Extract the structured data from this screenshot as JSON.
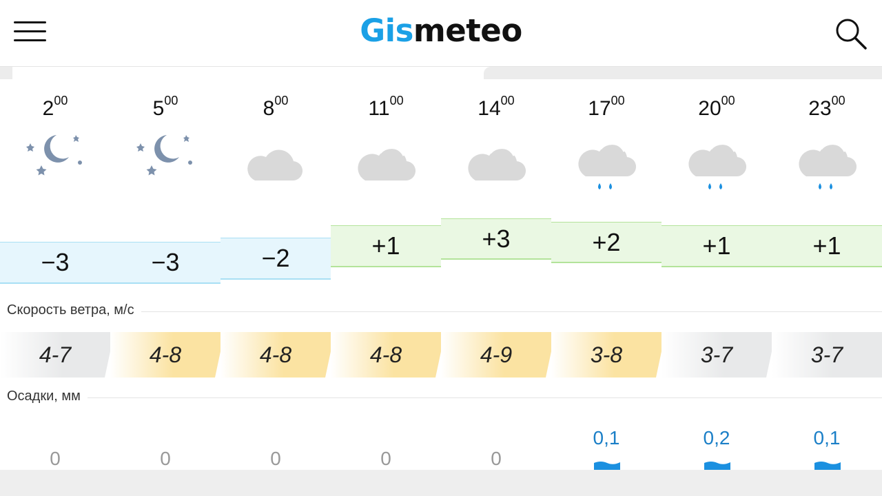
{
  "header": {
    "logo_part1": "Gis",
    "logo_part2": "meteo"
  },
  "forecast": [
    {
      "hour": "2",
      "minutes": "00",
      "icon": "moon-stars-icon",
      "temp": "−3",
      "wind": "4-7",
      "precip": "0"
    },
    {
      "hour": "5",
      "minutes": "00",
      "icon": "moon-stars-icon",
      "temp": "−3",
      "wind": "4-8",
      "precip": "0"
    },
    {
      "hour": "8",
      "minutes": "00",
      "icon": "cloud-moon-icon",
      "temp": "−2",
      "wind": "4-8",
      "precip": "0"
    },
    {
      "hour": "11",
      "minutes": "00",
      "icon": "cloud-icon",
      "temp": "+1",
      "wind": "4-8",
      "precip": "0"
    },
    {
      "hour": "14",
      "minutes": "00",
      "icon": "cloud-icon",
      "temp": "+3",
      "wind": "4-9",
      "precip": "0"
    },
    {
      "hour": "17",
      "minutes": "00",
      "icon": "cloud-rain-icon",
      "temp": "+2",
      "wind": "3-8",
      "precip": "0,1"
    },
    {
      "hour": "20",
      "minutes": "00",
      "icon": "cloud-rain-icon",
      "temp": "+1",
      "wind": "3-7",
      "precip": "0,2"
    },
    {
      "hour": "23",
      "minutes": "00",
      "icon": "cloud-rain-icon",
      "temp": "+1",
      "wind": "3-7",
      "precip": "0,1"
    }
  ],
  "labels": {
    "wind_speed": "Скорость ветра, м/с",
    "precipitation": "Осадки, мм"
  },
  "colors": {
    "brand_blue": "#1aa0e6",
    "cold_fill": "#e6f6fd",
    "cold_line": "#a8dff4",
    "warm_fill": "#eaf8e3",
    "warm_line": "#b3e39a",
    "wind_yellow": "#fbe3a2",
    "wind_gray": "#e8e9ea",
    "rain_blue": "#1b90e0"
  }
}
